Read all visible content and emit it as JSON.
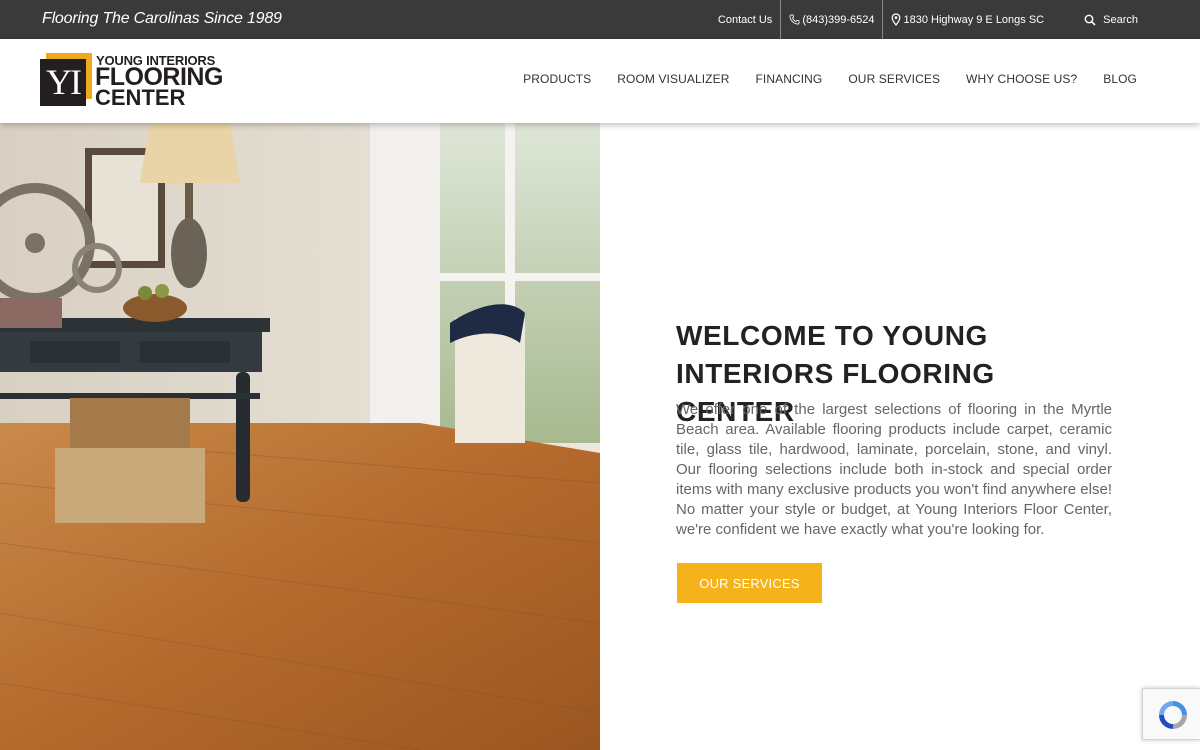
{
  "topbar": {
    "tagline": "Flooring The Carolinas Since 1989",
    "contact": "Contact Us",
    "phone": "(843)399-6524",
    "address": "1830 Highway 9 E Longs SC",
    "search": "Search"
  },
  "logo": {
    "mark": "YI",
    "line1": "YOUNG INTERIORS",
    "line2": "FLOORING",
    "line3": "CENTER"
  },
  "nav": [
    "PRODUCTS",
    "ROOM VISUALIZER",
    "FINANCING",
    "OUR SERVICES",
    "WHY CHOOSE US?",
    "BLOG"
  ],
  "welcome": {
    "title": "WELCOME TO YOUNG INTERIORS FLOORING CENTER",
    "body": "We offer one of the largest selections of flooring in the Myrtle Beach area. Available flooring products include carpet, ceramic tile, glass tile, hardwood, laminate, porcelain, stone, and vinyl. Our flooring selections include both in-stock and special order items with many exclusive products you won't find anywhere else! No matter your style or budget, at Young Interiors Floor Center, we're confident we have exactly what you're looking for.",
    "cta": "OUR SERVICES"
  },
  "colors": {
    "topbar": "#3a3a3b",
    "accent": "#f5b21b",
    "logo_gold": "#f0a81c"
  }
}
